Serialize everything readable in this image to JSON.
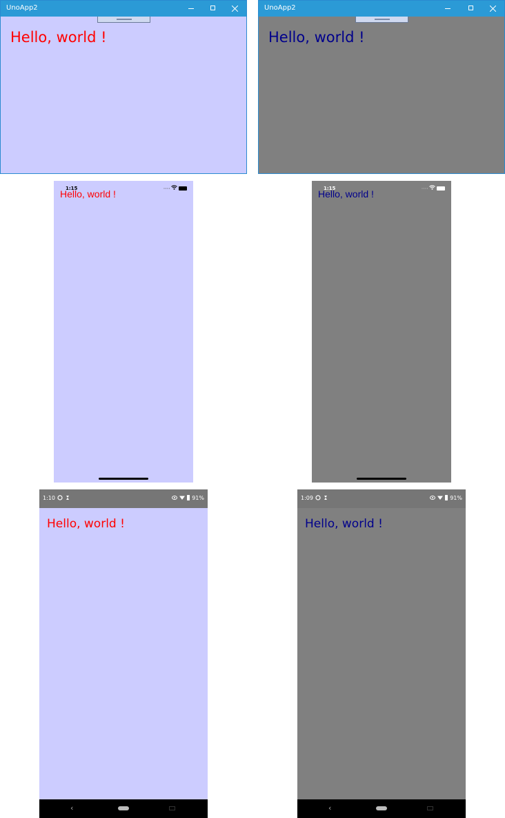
{
  "app": {
    "title": "UnoApp2",
    "hello_text": "Hello, world !"
  },
  "themes": {
    "light": {
      "background": "#ccccff",
      "text": "#ff0000"
    },
    "dark": {
      "background": "#808080",
      "text": "#00008b"
    }
  },
  "ios": {
    "time": "1:15"
  },
  "android": {
    "light_time": "1:10",
    "dark_time": "1:09",
    "battery": "91%",
    "back_glyph": "‹"
  },
  "icons": {
    "minimize": "minimize-icon",
    "maximize": "maximize-icon",
    "close": "close-icon",
    "wifi": "wifi-icon",
    "battery": "battery-icon",
    "signal": "cellular-signal-icon",
    "eye": "eye-icon",
    "sync": "sync-icon",
    "back": "back-icon",
    "home": "home-pill-icon",
    "recent": "recent-apps-icon"
  }
}
